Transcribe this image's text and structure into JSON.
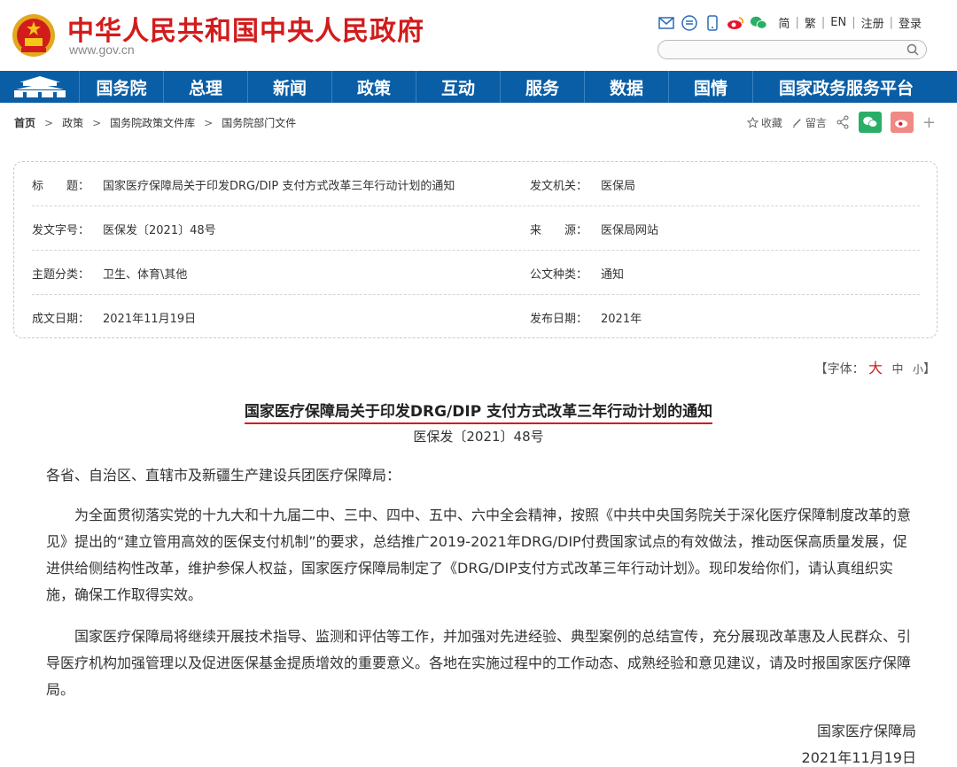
{
  "header": {
    "site_title": "中华人民共和国中央人民政府",
    "site_url": "www.gov.cn",
    "links": [
      "简",
      "繁",
      "EN",
      "注册",
      "登录"
    ],
    "icons": [
      "mail-icon",
      "rss-icon",
      "mobile-icon",
      "weibo-icon",
      "wechat-icon"
    ]
  },
  "nav": {
    "items": [
      "国务院",
      "总理",
      "新闻",
      "政策",
      "互动",
      "服务",
      "数据",
      "国情",
      "国家政务服务平台"
    ]
  },
  "breadcrumb": {
    "items": [
      "首页",
      "政策",
      "国务院政策文件库",
      "国务院部门文件"
    ],
    "sep": ">"
  },
  "share": {
    "favorite": "收藏",
    "comment": "留言"
  },
  "info": {
    "rows": [
      {
        "l1": "标　　题：",
        "v1": "国家医疗保障局关于印发DRG/DIP 支付方式改革三年行动计划的通知",
        "l2": "发文机关：",
        "v2": "医保局"
      },
      {
        "l1": "发文字号：",
        "v1": "医保发〔2021〕48号",
        "l2": "来　　源：",
        "v2": "医保局网站"
      },
      {
        "l1": "主题分类：",
        "v1": "卫生、体育\\其他",
        "l2": "公文种类：",
        "v2": "通知"
      },
      {
        "l1": "成文日期：",
        "v1": "2021年11月19日",
        "l2": "发布日期：",
        "v2": "2021年"
      }
    ]
  },
  "fontsize": {
    "label": "【字体：",
    "large": "大",
    "medium": "中",
    "small": "小",
    "close": "】"
  },
  "article": {
    "title": "国家医疗保障局关于印发DRG/DIP 支付方式改革三年行动计划的通知",
    "doc_no": "医保发〔2021〕48号",
    "salutation": "各省、自治区、直辖市及新疆生产建设兵团医疗保障局：",
    "para1": "　　为全面贯彻落实党的十九大和十九届二中、三中、四中、五中、六中全会精神，按照《中共中央国务院关于深化医疗保障制度改革的意见》提出的“建立管用高效的医保支付机制”的要求，总结推广2019-2021年DRG/DIP付费国家试点的有效做法，推动医保高质量发展，促进供给侧结构性改革，维护参保人权益，国家医疗保障局制定了《DRG/DIP支付方式改革三年行动计划》。现印发给你们，请认真组织实施，确保工作取得实效。",
    "para2": "　　国家医疗保障局将继续开展技术指导、监测和评估等工作，并加强对先进经验、典型案例的总结宣传，充分展现改革惠及人民群众、引导医疗机构加强管理以及促进医保基金提质增效的重要意义。各地在实施过程中的工作动态、成熟经验和意见建议，请及时报国家医疗保障局。",
    "signer": "国家医疗保障局",
    "date": "2021年11月19日"
  },
  "colors": {
    "brand_red": "#d21c1c",
    "nav_blue": "#0a5ea5"
  }
}
